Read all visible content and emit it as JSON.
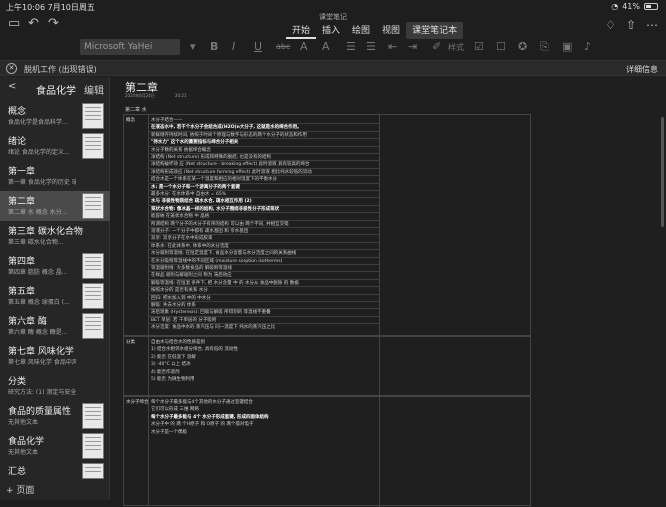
{
  "status": {
    "time": "上午10:06",
    "date": "7月10日周五",
    "battery": "41%"
  },
  "app": {
    "title": "课堂笔记"
  },
  "tabs": [
    {
      "label": "开始",
      "active": true
    },
    {
      "label": "插入"
    },
    {
      "label": "绘图"
    },
    {
      "label": "视图"
    },
    {
      "label": "课堂笔记本"
    }
  ],
  "format": {
    "font": "Microsoft YaHei",
    "style_label": "样式"
  },
  "errorbar": {
    "message": "脱机工作 (出现错误)",
    "detail": "详细信息"
  },
  "sidebar": {
    "back": "<",
    "section": "食品化学",
    "edit": "编辑",
    "pages": [
      {
        "title": "概念",
        "sub": "食品化学是食品科学..."
      },
      {
        "title": "绪论",
        "sub": "绪论 食品化学的定义..."
      },
      {
        "title": "第一章",
        "sub": "第一章 食品化学的历史 瑞典..."
      },
      {
        "title": "第二章",
        "sub": "第二章 水 概念 水分...",
        "active": true
      },
      {
        "title": "第三章 碳水化合物",
        "sub": "第三章 碳水化合物..."
      },
      {
        "title": "第四章",
        "sub": "第四章 脂肪 概念 晶..."
      },
      {
        "title": "第五章",
        "sub": "第五章 概念 球蛋白 (..."
      },
      {
        "title": "第六章 酶",
        "sub": "第六章 酶 概念 酶是..."
      },
      {
        "title": "第七章 风味化学",
        "sub": "第七章 风味化学 食品中风味..."
      },
      {
        "title": "分类",
        "sub": "研究方法: (1) 测定与安全, ..."
      },
      {
        "title": "食品的质量属性",
        "sub": "无其他文本"
      },
      {
        "title": "食品化学",
        "sub": "无其他文本"
      },
      {
        "title": "汇总",
        "sub": ""
      }
    ],
    "add_page": "+ 页面"
  },
  "page": {
    "title": "第二章",
    "date": "2020年6月24日",
    "time": "20:21",
    "section_label": "第二章 水",
    "rows": [
      {
        "label": "概念",
        "lines": [
          {
            "t": "水分子结合——",
            "b": false
          },
          {
            "t": "在液态水中, 若干个水分子会结合成(H2O)n大分子, 这就是水的缔合作用。",
            "b": true
          },
          {
            "t": "新鲜储存持续时间, 依照于时间个原理与数字与形态的两个水分子的状态和作用",
            "b": false
          },
          {
            "t": "\"持水力\" 这个水的重要指标与缔合分子相关",
            "b": true
          },
          {
            "t": "水分子数的关系 依据缔合概念",
            "b": false
          },
          {
            "t": "净结构 (Net structure) 形成和特殊的脱结, 也是没有的结构",
            "b": false
          },
          {
            "t": "净结构破坏效 应 (Net structure - breaking effect) 此时溶液 具有较高的缔合",
            "b": false
          },
          {
            "t": "净结构形成效应 (Net structure forming effect) 此时溶液 相比纯水较低的流动",
            "b": false
          },
          {
            "t": "结合水是一个体系在某一个温度和相应的相对湿度下的平衡水分",
            "b": false
          },
          {
            "t": "水: 是一个水分子和一个游离分子的两个氢键",
            "b": true
          },
          {
            "t": "最多水分: 在水体系中 自由水 = 65%",
            "b": false
          },
          {
            "t": "水与 非极性物质结合 疏水水合, 疏水相互作用 (2)",
            "b": true
          },
          {
            "t": "笼状水合物: 像冰晶一样的结构, 水分子围绕非极性分子形成笼状",
            "b": true
          },
          {
            "t": "能容纳 在笼状水合物 中 晶格",
            "b": false
          },
          {
            "t": "所谓结构 两个分子的水分子有序的结构 可以由 两个不同, 并相互交错",
            "b": false
          },
          {
            "t": "溶液分子: 一个分子中都有 疏水基团 和 亲水基团",
            "b": false
          },
          {
            "t": "双亲: 双亲分子在水中形成胶束",
            "b": false
          },
          {
            "t": "体系水: 在此体系中, 体系中的水分活度",
            "b": false
          },
          {
            "t": "水分吸附等温线: 在恒定温度下, 食品水分含量与水分活度之间的关系曲线",
            "b": false
          },
          {
            "t": "在水分吸附等温线中的不同区域 (moisture sorption isotherms)",
            "b": false
          },
          {
            "t": "等温吸附线: 大多数食品的 解吸附等温线",
            "b": false
          },
          {
            "t": "在样品 吸附与解吸附之间 称为 滞后效应",
            "b": false
          },
          {
            "t": "解吸等温线: 在恒温 条件下, 把 水分含量 中 的 水分从 食品中脱除 的 数据",
            "b": false
          },
          {
            "t": "按照水分的 是否有关系 水分",
            "b": false
          },
          {
            "t": "回归: 把水加入到 中的 中水分",
            "b": false
          },
          {
            "t": "解吸: 失去水分的 体系",
            "b": false
          },
          {
            "t": "滞后现象 (Hysteresis): 回吸与解吸 所得到的 等温线不重叠",
            "b": false
          },
          {
            "t": "BET 单层: 若 干单层的 分子吸附",
            "b": false
          },
          {
            "t": "水分活度: 食品中水的 蒸汽压与 同一温度下 纯水的蒸汽压之比",
            "b": false
          }
        ]
      },
      {
        "label": "分类",
        "lines": [
          {
            "t": "自由水与结合水的性质差别",
            "b": false
          },
          {
            "t": "1) 结合水相邻水组分缔合, 具有低的 流动性",
            "b": false
          },
          {
            "t": "2) 能否 在低温下 溶解",
            "b": false
          },
          {
            "t": "3) -40°C 以上 结冰",
            "b": false
          },
          {
            "t": "4) 能否作溶剂",
            "b": false
          },
          {
            "t": "5) 能否 为微生物利用",
            "b": false
          }
        ]
      },
      {
        "label": "水分子缔合",
        "lines": [
          {
            "t": "每个水分子最多能与4个其他的水分子通过氢键结合",
            "b": false
          },
          {
            "t": "它们可以形成 三维 网络",
            "b": false
          },
          {
            "t": "每个水分子最多能与 4个 水分子形成氢键, 形成四面体结构",
            "b": true
          },
          {
            "t": "水分子中 的 两 个H原子 和 O原子 的 两个孤对电子",
            "b": false
          },
          {
            "t": "水分子是一个偶极",
            "b": false
          }
        ]
      }
    ]
  }
}
